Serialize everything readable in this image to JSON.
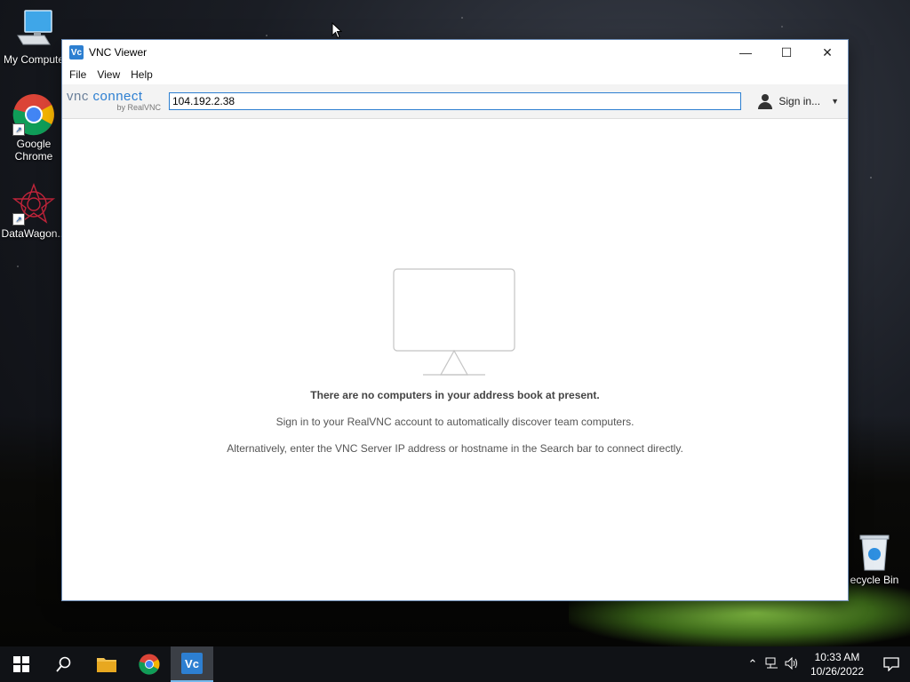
{
  "desktop": {
    "icons": [
      {
        "label": "My Compute"
      },
      {
        "label": "Google Chrome"
      },
      {
        "label": "DataWagon..."
      }
    ],
    "recycle_bin": {
      "label": "ecycle Bin"
    }
  },
  "window": {
    "title": "VNC Viewer",
    "controls": {
      "minimize": "—",
      "maximize": "☐",
      "close": "✕"
    },
    "menu": [
      "File",
      "View",
      "Help"
    ],
    "brand": {
      "main_prefix": "vnc",
      "main_suffix": "connect",
      "sub": "by RealVNC"
    },
    "search": {
      "value": "104.192.2.38"
    },
    "signin": {
      "label": "Sign in..."
    },
    "empty_state": {
      "title": "There are no computers in your address book at present.",
      "line1": "Sign in to your RealVNC account to automatically discover team computers.",
      "line2": "Alternatively, enter the VNC Server IP address or hostname in the Search bar to connect directly."
    }
  },
  "taskbar": {
    "clock": {
      "time": "10:33 AM",
      "date": "10/26/2022"
    },
    "apps": [
      "start-icon",
      "search-icon",
      "file-explorer-icon",
      "chrome-icon",
      "vnc-viewer-icon"
    ]
  },
  "colors": {
    "accent": "#2d7fd1",
    "taskbar": "#101216"
  }
}
